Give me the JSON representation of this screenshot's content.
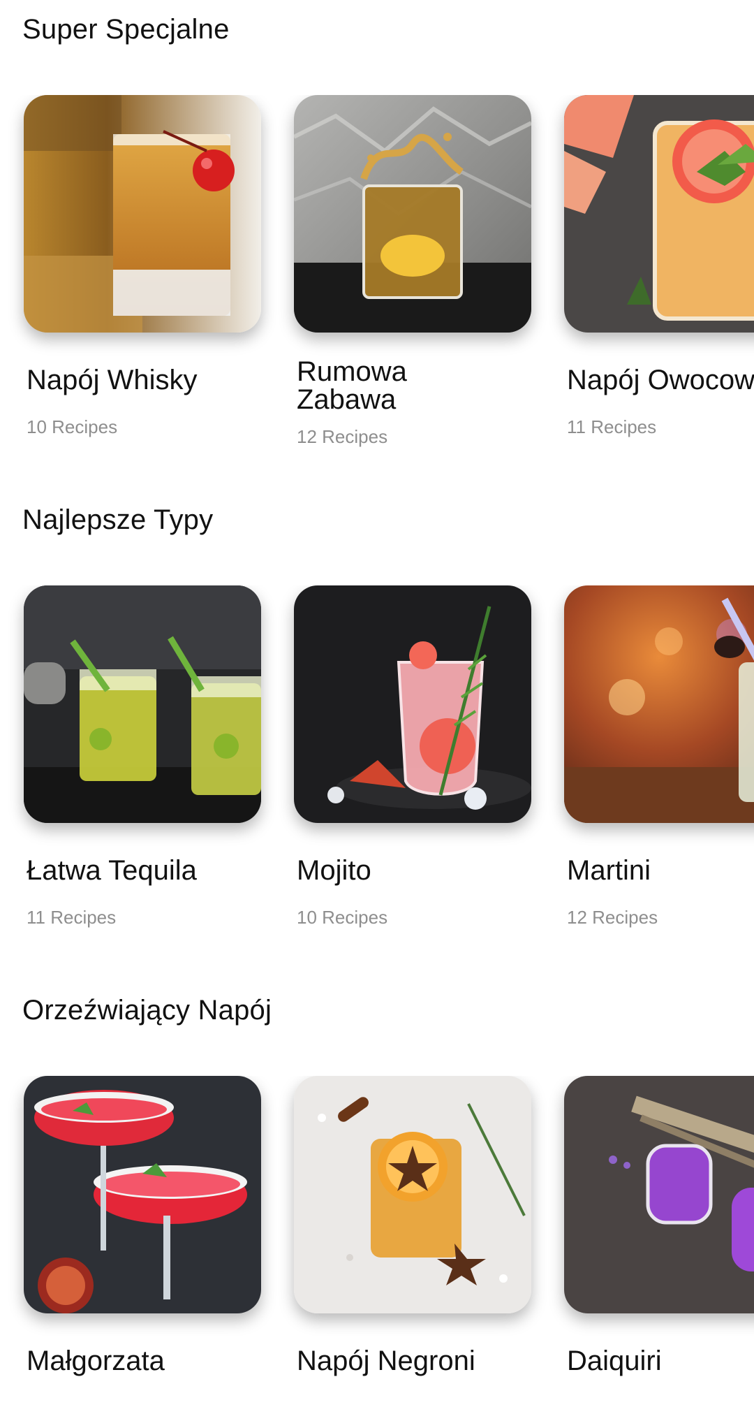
{
  "sections": [
    {
      "title": "Super Specjalne",
      "items": [
        {
          "name": "Napój Whisky",
          "count": "10 Recipes",
          "image": "whisky-glass-cherry"
        },
        {
          "name": "Rumowa\nZabawa",
          "count": "12 Recipes",
          "image": "rum-splash-glass"
        },
        {
          "name": "Napój Owocow",
          "count": "11 Recipes",
          "image": "grapefruit-drink"
        }
      ]
    },
    {
      "title": "Najlepsze Typy",
      "items": [
        {
          "name": "Łatwa Tequila",
          "count": "11 Recipes",
          "image": "tequila-glasses-straws"
        },
        {
          "name": "Mojito",
          "count": "10 Recipes",
          "image": "pink-mojito-rosemary"
        },
        {
          "name": "Martini",
          "count": "12 Recipes",
          "image": "bar-lights-drink"
        }
      ]
    },
    {
      "title": "Orzeźwiający Napój",
      "items": [
        {
          "name": "Małgorzata",
          "count": "",
          "image": "red-margarita-glasses"
        },
        {
          "name": "Napój Negroni",
          "count": "",
          "image": "orange-cinnamon-drink"
        },
        {
          "name": "Daiquiri",
          "count": "",
          "image": "lavender-purple-drink"
        }
      ]
    }
  ]
}
